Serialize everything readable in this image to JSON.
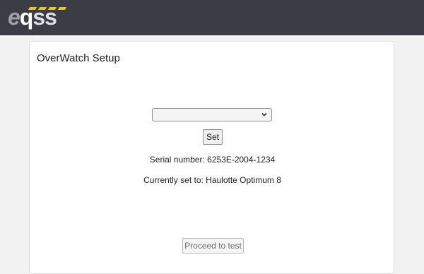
{
  "header": {
    "logo": {
      "text_e": "e",
      "text_q": "q",
      "text_ss": "ss",
      "accent_color": "#f2c418"
    },
    "background_color": "#3a3d43"
  },
  "card": {
    "title": "OverWatch Setup",
    "model_select": {
      "selected_value": "",
      "icon": "chevron-down-icon"
    },
    "set_button_label": "Set",
    "serial_text": "Serial number: 6253E-2004-1234",
    "current_text": "Currently set to: Haulotte Optimum 8",
    "proceed_button_label": "Proceed to test"
  }
}
